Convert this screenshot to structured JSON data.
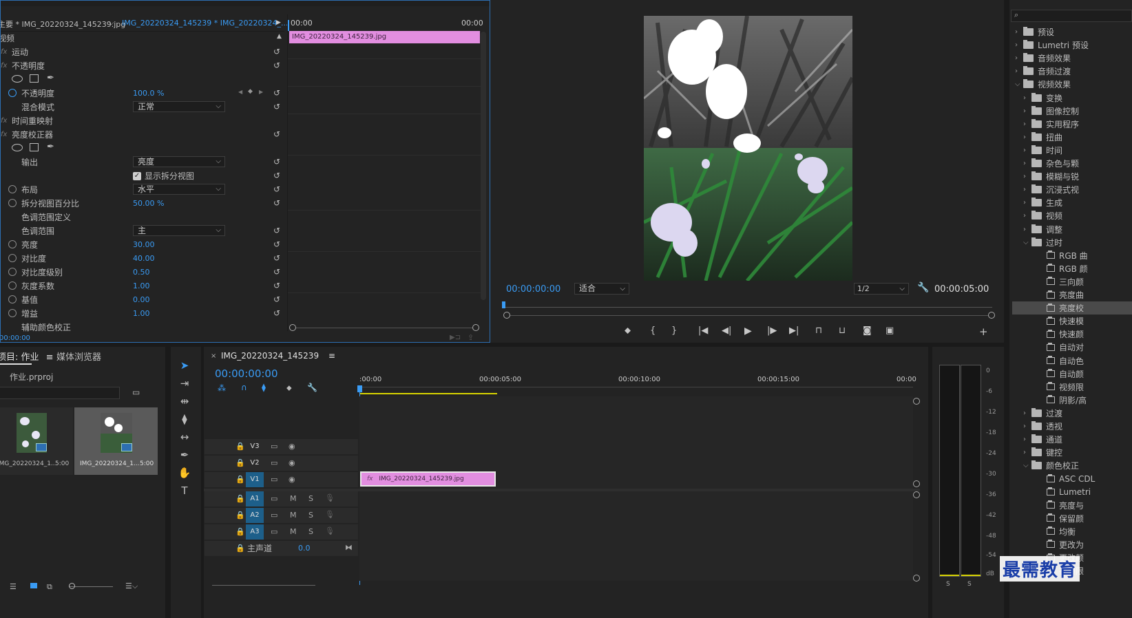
{
  "effect_controls": {
    "tab_source": "主要 * IMG_20220324_145239.jpg",
    "tab_sequence": "IMG_20220324_145239 * IMG_20220324_...",
    "video_header": "视频",
    "mini_time_start": "00:00",
    "mini_time_end": "00:00",
    "clip_label": "IMG_20220324_145239.jpg",
    "bottom_time": "00:00:00",
    "rows": {
      "motion": "运动",
      "opacity_group": "不透明度",
      "opacity": "不透明度",
      "opacity_value": "100.0 %",
      "blend_mode": "混合模式",
      "blend_value": "正常",
      "time_remap": "时间重映射",
      "brightness_corrector": "亮度校正器",
      "output": "输出",
      "output_value": "亮度",
      "show_split": "显示拆分视图",
      "layout": "布局",
      "layout_value": "水平",
      "split_percent": "拆分视图百分比",
      "split_percent_value": "50.00 %",
      "tonal_range_def": "色调范围定义",
      "tonal_range": "色调范围",
      "tonal_range_value": "主",
      "brightness": "亮度",
      "brightness_value": "30.00",
      "contrast": "对比度",
      "contrast_value": "40.00",
      "contrast_level": "对比度级别",
      "contrast_level_value": "0.50",
      "gamma": "灰度系数",
      "gamma_value": "1.00",
      "pedestal": "基值",
      "pedestal_value": "0.00",
      "gain": "增益",
      "gain_value": "1.00",
      "secondary": "辅助颜色校正"
    }
  },
  "program_monitor": {
    "timecode": "00:00:00:00",
    "fit_label": "适合",
    "resolution": "1/2",
    "duration": "00:00:05:00"
  },
  "project": {
    "tab_project": "项目: 作业",
    "tab_media": "媒体浏览器",
    "file_name": "作业.prproj",
    "items": [
      {
        "name": "IMG_20220324_1...",
        "duration": "5:00"
      },
      {
        "name": "IMG_20220324_1...",
        "duration": "5:00"
      }
    ]
  },
  "timeline": {
    "tab": "IMG_20220324_145239",
    "timecode": "00:00:00:00",
    "ruler": [
      ":00:00",
      "00:00:05:00",
      "00:00:10:00",
      "00:00:15:00",
      "00:00"
    ],
    "tracks": {
      "v3": "V3",
      "v2": "V2",
      "v1": "V1",
      "a1": "A1",
      "a2": "A2",
      "a3": "A3"
    },
    "mute": "M",
    "solo": "S",
    "master": "主声道",
    "master_value": "0.0",
    "clip": "IMG_20220324_145239.jpg"
  },
  "meter": {
    "scale": [
      "0",
      "-6",
      "-12",
      "-18",
      "-24",
      "-30",
      "-36",
      "-42",
      "-48",
      "-54",
      "dB"
    ],
    "solo_left": "S",
    "solo_right": "S"
  },
  "effects_panel": {
    "items": [
      {
        "label": "预设",
        "type": "folder",
        "level": 0,
        "open": false
      },
      {
        "label": "Lumetri 预设",
        "type": "folder",
        "level": 0,
        "open": false
      },
      {
        "label": "音频效果",
        "type": "folder",
        "level": 0,
        "open": false
      },
      {
        "label": "音频过渡",
        "type": "folder",
        "level": 0,
        "open": false
      },
      {
        "label": "视频效果",
        "type": "folder",
        "level": 0,
        "open": true
      },
      {
        "label": "变换",
        "type": "folder",
        "level": 1,
        "open": false
      },
      {
        "label": "图像控制",
        "type": "folder",
        "level": 1,
        "open": false
      },
      {
        "label": "实用程序",
        "type": "folder",
        "level": 1,
        "open": false
      },
      {
        "label": "扭曲",
        "type": "folder",
        "level": 1,
        "open": false
      },
      {
        "label": "时间",
        "type": "folder",
        "level": 1,
        "open": false
      },
      {
        "label": "杂色与颗",
        "type": "folder",
        "level": 1,
        "open": false
      },
      {
        "label": "模糊与锐",
        "type": "folder",
        "level": 1,
        "open": false
      },
      {
        "label": "沉浸式视",
        "type": "folder",
        "level": 1,
        "open": false
      },
      {
        "label": "生成",
        "type": "folder",
        "level": 1,
        "open": false
      },
      {
        "label": "视频",
        "type": "folder",
        "level": 1,
        "open": false
      },
      {
        "label": "调整",
        "type": "folder",
        "level": 1,
        "open": false
      },
      {
        "label": "过时",
        "type": "folder",
        "level": 1,
        "open": true
      },
      {
        "label": "RGB 曲",
        "type": "preset",
        "level": 2
      },
      {
        "label": "RGB 颜",
        "type": "preset",
        "level": 2
      },
      {
        "label": "三向颜",
        "type": "preset",
        "level": 2
      },
      {
        "label": "亮度曲",
        "type": "preset",
        "level": 2
      },
      {
        "label": "亮度校",
        "type": "preset",
        "level": 2,
        "selected": true
      },
      {
        "label": "快速模",
        "type": "preset",
        "level": 2
      },
      {
        "label": "快速颜",
        "type": "preset",
        "level": 2
      },
      {
        "label": "自动对",
        "type": "preset",
        "level": 2
      },
      {
        "label": "自动色",
        "type": "preset",
        "level": 2
      },
      {
        "label": "自动颜",
        "type": "preset",
        "level": 2
      },
      {
        "label": "视频限",
        "type": "preset",
        "level": 2
      },
      {
        "label": "阴影/高",
        "type": "preset",
        "level": 2
      },
      {
        "label": "过渡",
        "type": "folder",
        "level": 1,
        "open": false
      },
      {
        "label": "透视",
        "type": "folder",
        "level": 1,
        "open": false
      },
      {
        "label": "通道",
        "type": "folder",
        "level": 1,
        "open": false
      },
      {
        "label": "键控",
        "type": "folder",
        "level": 1,
        "open": false
      },
      {
        "label": "颜色校正",
        "type": "folder",
        "level": 1,
        "open": true
      },
      {
        "label": "ASC CDL",
        "type": "preset",
        "level": 2
      },
      {
        "label": "Lumetri",
        "type": "preset",
        "level": 2
      },
      {
        "label": "亮度与",
        "type": "preset",
        "level": 2
      },
      {
        "label": "保留颜",
        "type": "preset",
        "level": 2
      },
      {
        "label": "均衡",
        "type": "preset",
        "level": 2
      },
      {
        "label": "更改为",
        "type": "preset",
        "level": 2
      },
      {
        "label": "更改颜",
        "type": "preset",
        "level": 2
      },
      {
        "label": "视频限",
        "type": "preset",
        "level": 2
      }
    ]
  },
  "watermark": "最需教育",
  "colors": {
    "accent": "#3a9cf5",
    "clip": "#e28ee0",
    "panel": "#232323",
    "bg": "#1a1a1a"
  }
}
